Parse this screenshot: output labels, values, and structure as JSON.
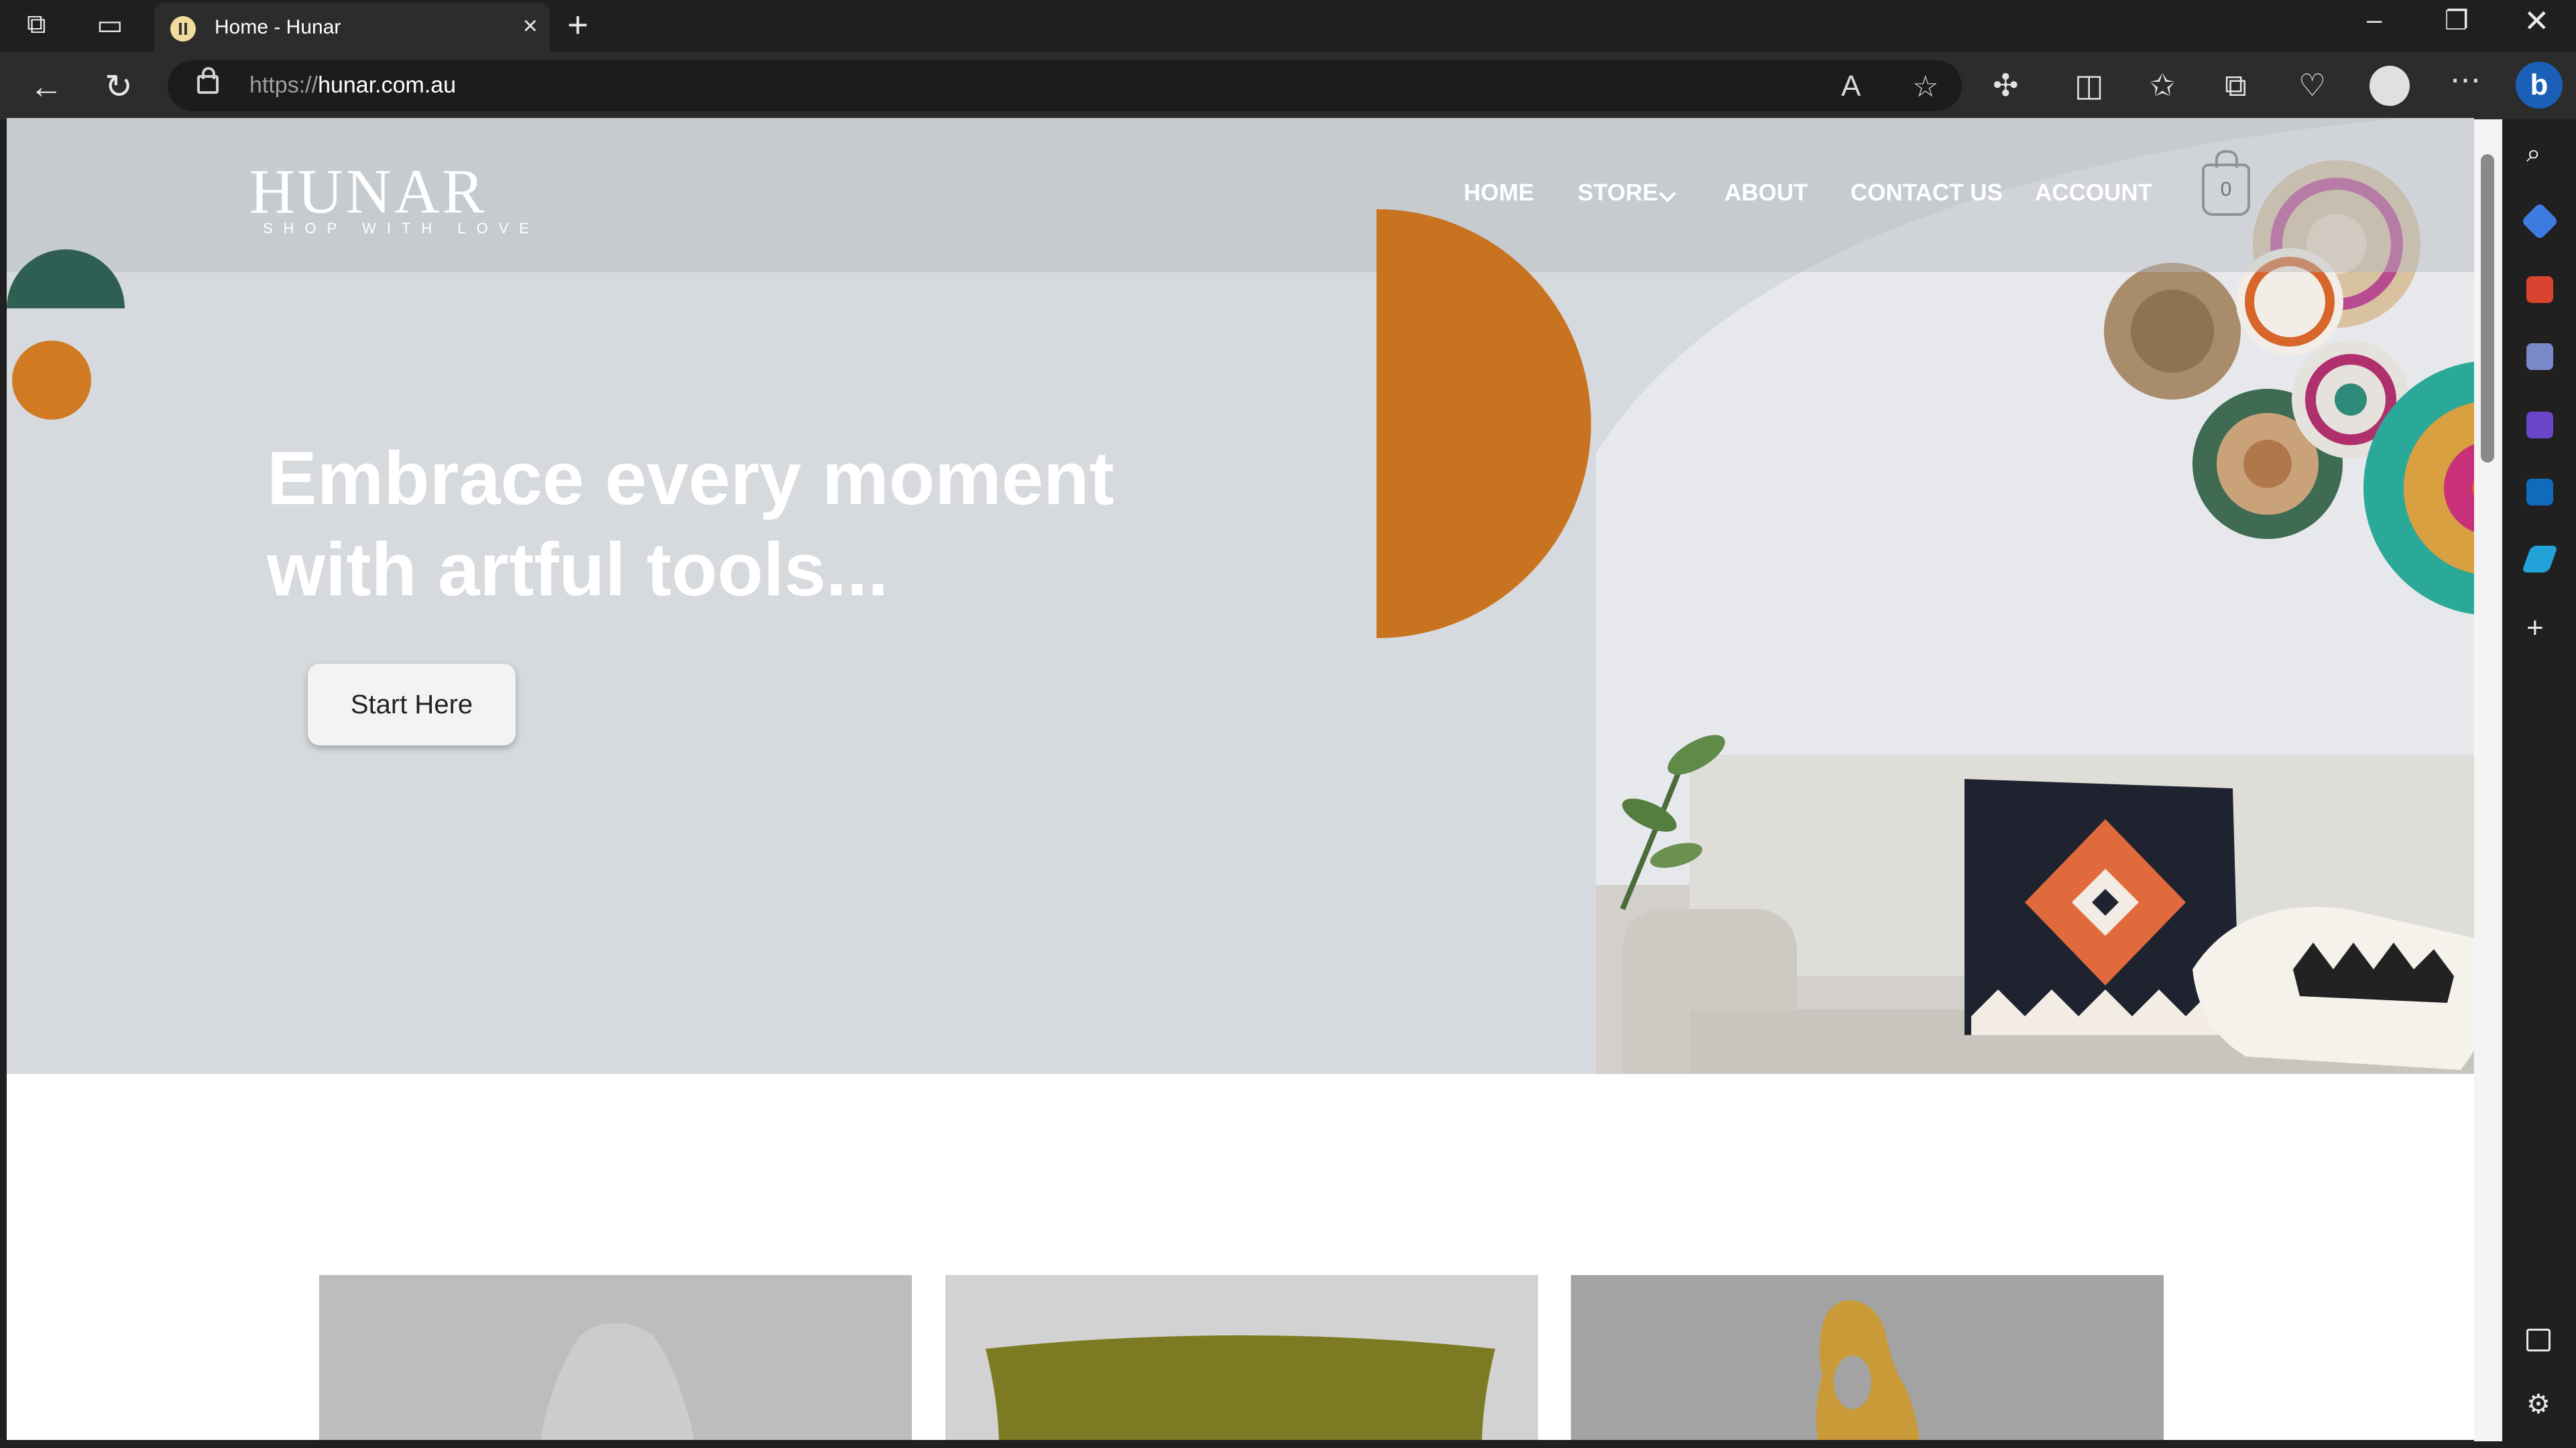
{
  "browser": {
    "tab_title": "Home - Hunar",
    "url_prefix": "https://",
    "url_domain": "hunar.com.au"
  },
  "site": {
    "logo": "HUNAR",
    "tagline": "SHOP WITH LOVE",
    "nav": {
      "home": "HOME",
      "store": "STORE",
      "about": "ABOUT",
      "contact": "CONTACT US",
      "account": "ACCOUNT"
    },
    "cart_count": "0",
    "hero_headline": "Embrace every moment with artful tools...",
    "cta_label": "Start Here"
  },
  "colors": {
    "accent_orange": "#c8731f",
    "accent_green": "#2e5f52",
    "hero_bg": "#d6d9dd"
  },
  "icons": [
    "workspaces-icon",
    "tab-actions-icon",
    "close-icon",
    "new-tab-icon",
    "minimize-icon",
    "restore-icon",
    "back-icon",
    "refresh-icon",
    "lock-icon",
    "read-aloud-icon",
    "favorite-star-icon",
    "extensions-icon",
    "split-screen-icon",
    "favorites-icon",
    "collections-icon",
    "browser-essentials-icon",
    "profile-icon",
    "more-icon",
    "copilot-icon",
    "search-icon",
    "shopping-icon",
    "tools-icon",
    "games-icon",
    "office-icon",
    "outlook-icon",
    "send-icon",
    "add-icon",
    "sidebar-toggle-icon",
    "settings-icon",
    "cart-icon",
    "chevron-down-icon"
  ]
}
